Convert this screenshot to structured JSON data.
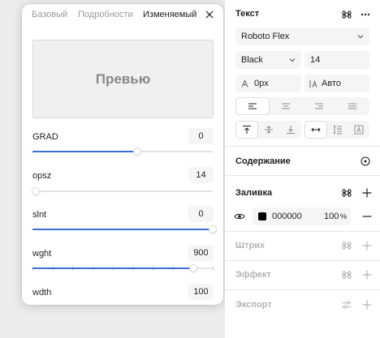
{
  "popover": {
    "tabs": [
      {
        "label": "Базовый"
      },
      {
        "label": "Подробности"
      },
      {
        "label": "Изменяемый",
        "active": true
      }
    ],
    "close_icon": "close-icon",
    "preview_text": "Превью",
    "axes": [
      {
        "label": "GRAD",
        "value": "0",
        "fraction": 0.58
      },
      {
        "label": "opsz",
        "value": "14",
        "fraction": 0.02
      },
      {
        "label": "slnt",
        "value": "0",
        "fraction": 1.0
      },
      {
        "label": "wght",
        "value": "900",
        "fraction": 0.89,
        "ticks": 9
      },
      {
        "label": "wdth",
        "value": "100"
      }
    ],
    "accent_color": "#3a6fd8"
  },
  "panel": {
    "text_section": {
      "title": "Текст",
      "font_family": "Roboto Flex",
      "font_weight": "Black",
      "font_size": "14",
      "letter_spacing": "0px",
      "line_height": "Авто",
      "align_options": [
        "left",
        "center",
        "right",
        "justify"
      ],
      "align_selected": "left",
      "vertical_options": [
        "top",
        "middle",
        "bottom"
      ],
      "vertical_selected": "top",
      "resize_options": [
        "auto-width",
        "auto-height",
        "fixed"
      ],
      "resize_selected": "auto-width"
    },
    "content_section": {
      "title": "Содержание"
    },
    "fill_section": {
      "title": "Заливка",
      "color_hex": "000000",
      "opacity": "100",
      "opacity_unit": "%",
      "swatch_color": "#000000"
    },
    "stroke_section": {
      "title": "Штрих"
    },
    "effect_section": {
      "title": "Эффект"
    },
    "export_section": {
      "title": "Экспорт"
    }
  }
}
